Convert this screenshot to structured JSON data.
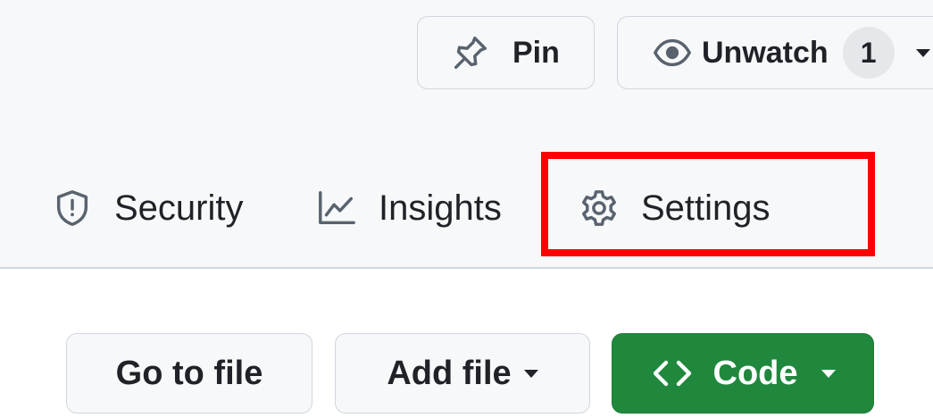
{
  "repo_actions": {
    "pin_label": "Pin",
    "unwatch_label": "Unwatch",
    "watch_count": "1"
  },
  "tabs": [
    {
      "label": "Security",
      "icon": "shield-icon"
    },
    {
      "label": "Insights",
      "icon": "graph-icon"
    },
    {
      "label": "Settings",
      "icon": "gear-icon"
    }
  ],
  "file_actions": {
    "goto_label": "Go to file",
    "add_file_label": "Add file",
    "code_label": "Code"
  },
  "colors": {
    "header_bg": "#f6f8fa",
    "code_button_bg": "#1f883d",
    "highlight": "#ff0000"
  }
}
